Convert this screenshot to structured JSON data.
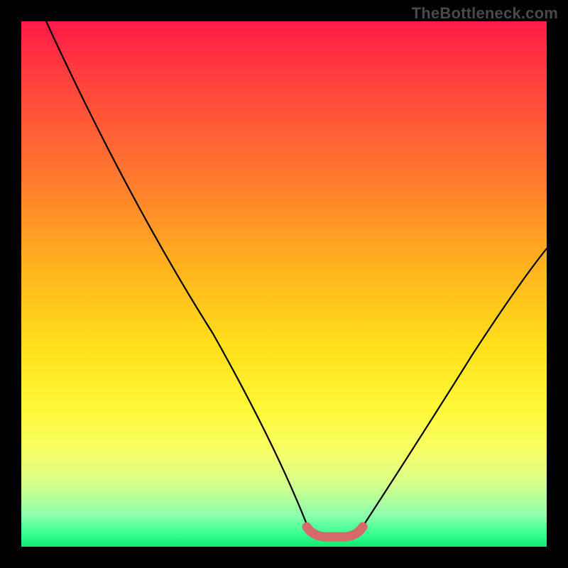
{
  "watermark": "TheBottleneck.com",
  "chart_data": {
    "type": "line",
    "title": "",
    "xlabel": "",
    "ylabel": "",
    "xlim": [
      0,
      100
    ],
    "ylim": [
      0,
      100
    ],
    "series": [
      {
        "name": "left-curve",
        "x": [
          5,
          15,
          25,
          35,
          45,
          52,
          56
        ],
        "values": [
          100,
          82,
          61,
          40,
          19,
          5,
          1
        ]
      },
      {
        "name": "right-curve",
        "x": [
          64,
          70,
          78,
          86,
          94,
          100
        ],
        "values": [
          1,
          8,
          20,
          32,
          44,
          54
        ]
      },
      {
        "name": "bottom-segment",
        "x": [
          56,
          58,
          60,
          62,
          64
        ],
        "values": [
          1,
          0.5,
          0.5,
          0.5,
          1
        ]
      }
    ],
    "gradient_stops": [
      {
        "pos": 0,
        "color": "#ff1a48"
      },
      {
        "pos": 30,
        "color": "#ff7a2e"
      },
      {
        "pos": 62,
        "color": "#ffe01a"
      },
      {
        "pos": 88,
        "color": "#d6ff8a"
      },
      {
        "pos": 100,
        "color": "#10e874"
      }
    ],
    "bottom_segment_color": "#d46a6a"
  }
}
